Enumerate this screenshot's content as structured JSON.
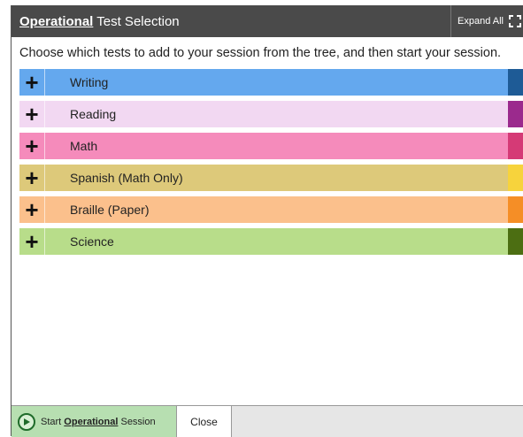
{
  "dialog": {
    "title_keyword": "Operational",
    "title_rest": " Test Selection",
    "expand_label": "Expand All",
    "instructions": "Choose which tests to add to your session from the tree, and then start your session."
  },
  "tests": [
    {
      "toggle": "+",
      "label": "Writing",
      "bg": "#64a8ee",
      "accent": "#1e5b96"
    },
    {
      "toggle": "+",
      "label": "Reading",
      "bg": "#f2d8f2",
      "accent": "#9b2a8d"
    },
    {
      "toggle": "+",
      "label": "Math",
      "bg": "#f58bbb",
      "accent": "#d53a76"
    },
    {
      "toggle": "+",
      "label": "Spanish (Math Only)",
      "bg": "#ddc97a",
      "accent": "#f7d33c"
    },
    {
      "toggle": "+",
      "label": "Braille (Paper)",
      "bg": "#fbc08c",
      "accent": "#f58e26"
    },
    {
      "toggle": "+",
      "label": "Science",
      "bg": "#b8dd8a",
      "accent": "#4c6e12"
    }
  ],
  "footer": {
    "start_prefix": "Start ",
    "start_keyword": "Operational",
    "start_suffix": " Session",
    "close_label": "Close"
  },
  "icons": {
    "expand": "expand-arrows-icon",
    "plus": "plus-icon",
    "play": "play-circle-icon"
  }
}
